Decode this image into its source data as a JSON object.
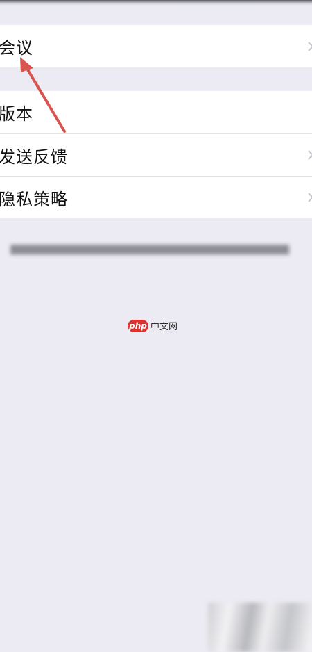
{
  "settings": {
    "rows_group1": [
      {
        "label": "会议"
      }
    ],
    "rows_group2": [
      {
        "label": "版本",
        "value": ""
      },
      {
        "label": "发送反馈"
      },
      {
        "label": "隐私策略"
      }
    ]
  },
  "watermark": {
    "badge": "php",
    "text": "中文网"
  },
  "colors": {
    "background": "#ecebf3",
    "row_background": "#ffffff",
    "arrow": "#d9534f",
    "watermark_badge": "#e0312e"
  },
  "icons": {
    "chevron": "chevron-right-icon",
    "annotation": "red-arrow-annotation"
  }
}
